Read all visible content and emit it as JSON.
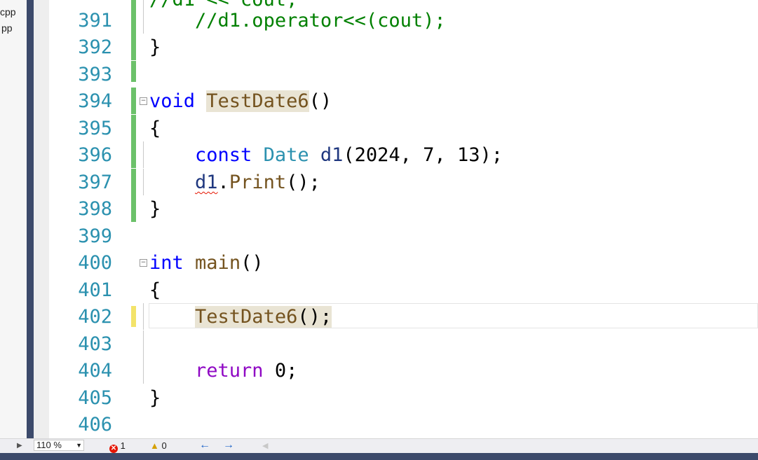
{
  "solution_explorer": {
    "files": [
      "cpp",
      "pp"
    ]
  },
  "editor": {
    "lines": [
      {
        "num": "391",
        "text": "//d1.operator<<(cout);"
      },
      {
        "num": "392",
        "text": "}"
      },
      {
        "num": "393",
        "text": ""
      },
      {
        "num": "394",
        "text": "void TestDate6()"
      },
      {
        "num": "395",
        "text": "{"
      },
      {
        "num": "396",
        "text": "const Date d1(2024, 7, 13);"
      },
      {
        "num": "397",
        "text": "d1.Print();"
      },
      {
        "num": "398",
        "text": "}"
      },
      {
        "num": "399",
        "text": ""
      },
      {
        "num": "400",
        "text": "int main()"
      },
      {
        "num": "401",
        "text": "{"
      },
      {
        "num": "402",
        "text": "TestDate6();"
      },
      {
        "num": "403",
        "text": ""
      },
      {
        "num": "404",
        "text": "return 0;"
      },
      {
        "num": "405",
        "text": "}"
      },
      {
        "num": "406",
        "text": ""
      }
    ],
    "tokens": {
      "l391_comment": "//d1.operator<<(cout);",
      "l392_brace": "}",
      "l394_void": "void",
      "l394_fn": "TestDate6",
      "l394_parens": "()",
      "l395_brace": "{",
      "l396_const": "const",
      "l396_type": "Date",
      "l396_var": "d1",
      "l396_args": "(2024, 7, 13);",
      "l397_var": "d1",
      "l397_dot": ".",
      "l397_fn": "Print",
      "l397_rest": "();",
      "l398_brace": "}",
      "l400_int": "int",
      "l400_fn": "main",
      "l400_parens": "()",
      "l401_brace": "{",
      "l402_fn_a": "TestDate",
      "l402_fn_b": "6",
      "l402_rest": "();",
      "l404_return": "return",
      "l404_rest": "0;",
      "l405_brace": "}"
    }
  },
  "status_bar": {
    "zoom": "110 %",
    "errors": "1",
    "warnings": "0",
    "nav_back": "←",
    "nav_forward": "→"
  },
  "colors": {
    "keyword": "#0000ff",
    "type": "#2b91af",
    "function": "#74531f",
    "comment": "#008000",
    "control": "#8f08c4",
    "line_number": "#2b91af",
    "change_saved": "#6cc16a",
    "change_unsaved": "#f3e36a"
  }
}
